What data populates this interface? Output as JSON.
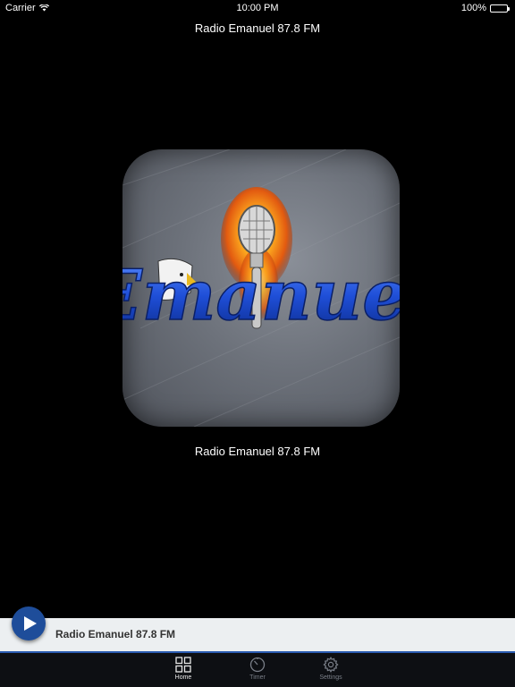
{
  "status_bar": {
    "carrier": "Carrier",
    "time": "10:00 PM",
    "battery": "100%"
  },
  "header": {
    "title": "Radio Emanuel 87.8 FM"
  },
  "artwork": {
    "logo_text": "Emanuel"
  },
  "station": {
    "caption": "Radio Emanuel 87.8 FM"
  },
  "mini_player": {
    "title": "Radio Emanuel 87.8 FM",
    "play_icon": "play-icon"
  },
  "tab_bar": {
    "items": [
      {
        "label": "Home",
        "icon": "grid-icon",
        "active": true
      },
      {
        "label": "Timer",
        "icon": "timer-icon",
        "active": false
      },
      {
        "label": "Settings",
        "icon": "gear-icon",
        "active": false
      }
    ]
  },
  "colors": {
    "accent": "#1e4d9a",
    "tab_border": "#2a5bb0",
    "background": "#000000"
  }
}
